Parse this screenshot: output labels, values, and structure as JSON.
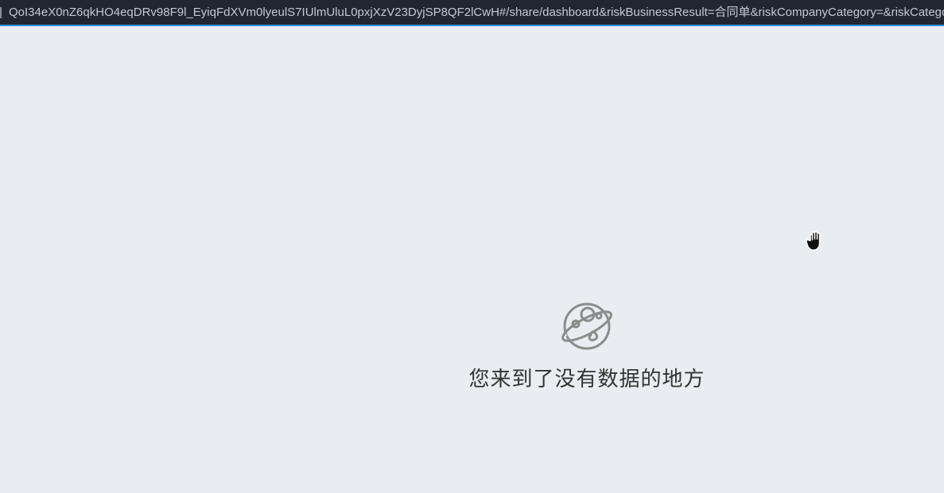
{
  "address_bar": {
    "url": "QoI34eX0nZ6qkHO4eqDRv98F9l_EyiqFdXVm0lyeulS7IUlmUluL0pxjXzV23DyjSP8QF2lCwH#/share/dashboard&riskBusinessResult=合同单&riskCompanyCategory=&riskCategoryPie="
  },
  "empty_state": {
    "icon": "planet-icon",
    "message": "您来到了没有数据的地方"
  },
  "cursor": {
    "icon": "hand-cursor-icon"
  },
  "colors": {
    "page_background": "#e9ecf1",
    "address_bar_background": "#1f2733",
    "address_bar_accent": "#2f8fd8",
    "icon_gray": "#8c8c8c",
    "message_text": "#333333"
  }
}
